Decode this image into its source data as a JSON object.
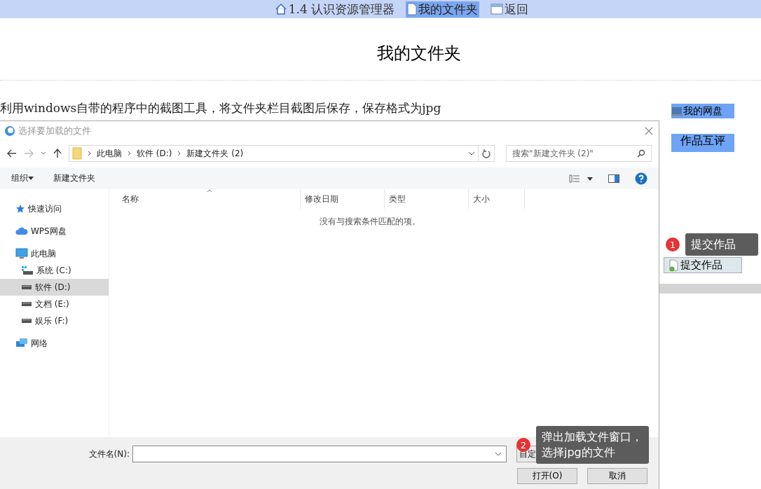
{
  "nav": [
    {
      "label": "1.4 认识资源管理器",
      "kind": "home",
      "selected": false
    },
    {
      "label": "我的文件夹",
      "kind": "page",
      "selected": true
    },
    {
      "label": "返回",
      "kind": "window",
      "selected": false
    }
  ],
  "page": {
    "title": "我的文件夹",
    "instruction": "利用windows自带的程序中的截图工具，将文件夹栏目截图后保存，保存格式为jpg"
  },
  "side_buttons": [
    {
      "label": "我的网盘",
      "kind": "icon"
    },
    {
      "label": "作品互评",
      "kind": "plain"
    }
  ],
  "submit_button": {
    "label": "提交作品"
  },
  "tips": [
    {
      "number": "1",
      "text": "提交作品"
    },
    {
      "number": "2",
      "text": "弹出加载文件窗口，选择jpg的文件"
    }
  ],
  "dialog": {
    "title": "选择要加载的文件",
    "breadcrumb": [
      "此电脑",
      "软件 (D:)",
      "新建文件夹 (2)"
    ],
    "search_placeholder": "搜索\"新建文件夹 (2)\"",
    "organize": "组织",
    "new_folder": "新建文件夹",
    "sidebar": [
      {
        "label": "快速访问",
        "kind": "star",
        "selected": false
      },
      {
        "label": "WPS网盘",
        "kind": "cloud",
        "selected": false
      },
      {
        "label": "此电脑",
        "kind": "computer",
        "selected": false,
        "children": [
          {
            "label": "系统 (C:)",
            "kind": "system-drive",
            "selected": false
          },
          {
            "label": "软件 (D:)",
            "kind": "drive",
            "selected": true
          },
          {
            "label": "文档 (E:)",
            "kind": "drive",
            "selected": false
          },
          {
            "label": "娱乐 (F:)",
            "kind": "drive",
            "selected": false
          }
        ]
      },
      {
        "label": "网络",
        "kind": "network",
        "selected": false
      }
    ],
    "columns": [
      "名称",
      "修改日期",
      "类型",
      "大小"
    ],
    "empty_message": "没有与搜索条件匹配的项。",
    "filename_label": "文件名(N):",
    "file_type": "自定",
    "buttons": [
      "打开(O)",
      "取消"
    ]
  }
}
